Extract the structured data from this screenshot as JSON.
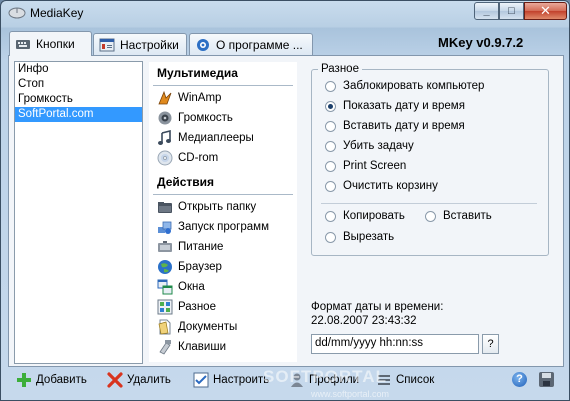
{
  "window": {
    "title": "MediaKey",
    "app_icon": "mouse-icon"
  },
  "window_controls": {
    "minimize": "_",
    "maximize": "□",
    "close": "✕"
  },
  "tabs": [
    {
      "label": "Кнопки",
      "icon": "keyboard-icon",
      "active": true
    },
    {
      "label": "Настройки",
      "icon": "settings-icon",
      "active": false
    },
    {
      "label": "О программе ...",
      "icon": "info-icon",
      "active": false
    }
  ],
  "version": "MKey v0.9.7.2",
  "buttons_list": [
    {
      "label": "Инфо",
      "selected": false
    },
    {
      "label": "Стоп",
      "selected": false
    },
    {
      "label": "Громкость",
      "selected": false
    },
    {
      "label": "SoftPortal.com",
      "selected": true
    }
  ],
  "groups": {
    "multimedia": {
      "title": "Мультимедиа",
      "items": [
        {
          "label": "WinAmp",
          "icon": "winamp-icon"
        },
        {
          "label": "Громкость",
          "icon": "speaker-icon"
        },
        {
          "label": "Медиаплееры",
          "icon": "music-note-icon"
        },
        {
          "label": "CD-rom",
          "icon": "cd-icon"
        }
      ]
    },
    "actions": {
      "title": "Действия",
      "items": [
        {
          "label": "Открыть папку",
          "icon": "folder-icon"
        },
        {
          "label": "Запуск программ",
          "icon": "programs-icon"
        },
        {
          "label": "Питание",
          "icon": "power-icon"
        },
        {
          "label": "Браузер",
          "icon": "globe-icon"
        },
        {
          "label": "Окна",
          "icon": "windows-icon"
        },
        {
          "label": "Разное",
          "icon": "misc-icon"
        },
        {
          "label": "Документы",
          "icon": "document-icon"
        },
        {
          "label": "Клавиши",
          "icon": "keys-icon"
        }
      ]
    }
  },
  "misc_group": {
    "title": "Разное",
    "options": [
      {
        "label": "Заблокировать компьютер",
        "checked": false
      },
      {
        "label": "Показать дату и время",
        "checked": true
      },
      {
        "label": "Вставить дату и время",
        "checked": false
      },
      {
        "label": "Убить задачу",
        "checked": false
      },
      {
        "label": "Print Screen",
        "checked": false
      },
      {
        "label": "Очистить корзину",
        "checked": false
      }
    ],
    "clipboard_options": [
      {
        "label": "Копировать",
        "checked": false
      },
      {
        "label": "Вставить",
        "checked": false
      },
      {
        "label": "Вырезать",
        "checked": false
      }
    ]
  },
  "date_format": {
    "label": "Формат даты и времени:",
    "preview": "22.08.2007 23:43:32",
    "value": "dd/mm/yyyy hh:nn:ss",
    "help_button": "?"
  },
  "toolbar": {
    "add": "Добавить",
    "delete": "Удалить",
    "configure": "Настроить",
    "profiles": "Профили",
    "list": "Список",
    "help": "?"
  },
  "watermark": {
    "text": "SOFTPORTAL",
    "url": "www.softportal.com"
  },
  "colors": {
    "selection": "#3399ff",
    "panel": "#f2f5f9",
    "close_button": "#c2412c"
  }
}
